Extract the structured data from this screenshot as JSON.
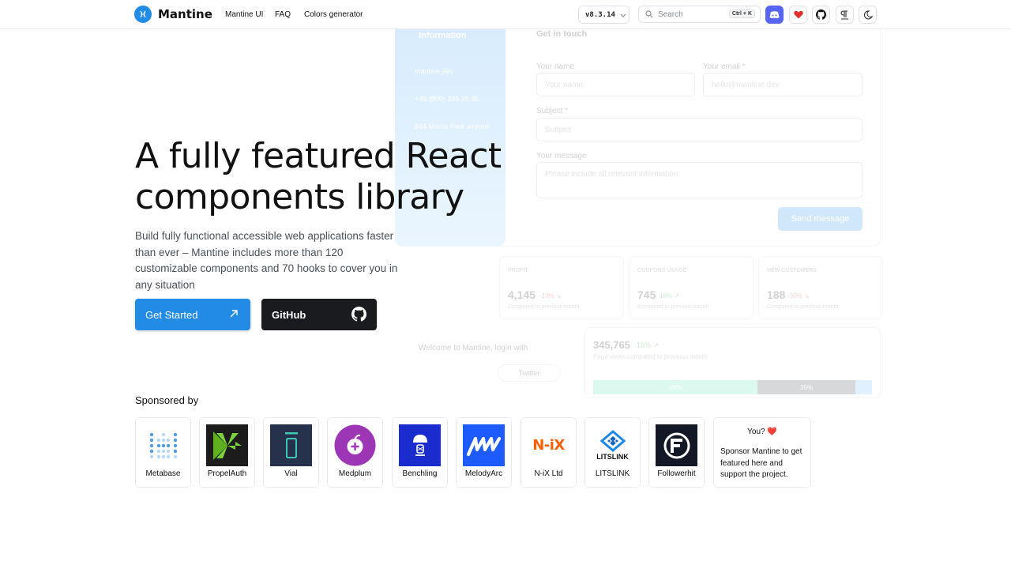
{
  "header": {
    "brand": "Mantine",
    "nav": [
      "Mantine UI",
      "FAQ",
      "Colors generator"
    ],
    "version": "v8.3.14",
    "search_placeholder": "Search",
    "search_shortcut": "Ctrl + K"
  },
  "background_demo": {
    "contact_title": "Get in touch",
    "info_title": "Information",
    "info_items": [
      "mantine.dev",
      "+49 (800) 335 35 35",
      "844 Morris Park avenue"
    ],
    "fields": {
      "name_label": "Your name",
      "name_placeholder": "Your name",
      "email_label": "Your email *",
      "email_placeholder": "hello@mantine.dev",
      "subject_label": "Subject *",
      "subject_placeholder": "Subject",
      "message_label": "Your message",
      "message_placeholder": "Please include all relevant information"
    },
    "send_button": "Send message",
    "stats": [
      {
        "label": "PROFIT",
        "value": "4,145",
        "diff": "-13% ↘",
        "caption": "Compared to previous month"
      },
      {
        "label": "COUPONS USAGE",
        "value": "745",
        "diff": "18% ↗",
        "caption": "Compared to previous month"
      },
      {
        "label": "NEW CUSTOMERS",
        "value": "188",
        "diff": "-30% ↘",
        "caption": "Compared to previous month"
      }
    ],
    "page_views": {
      "value": "345,765",
      "diff": "18% ↗",
      "caption": "Page views compared to previous month",
      "segments": [
        "59%",
        "35%"
      ]
    },
    "login_text": "Welcome to Mantine, login with",
    "twitter_button": "Twitter"
  },
  "hero": {
    "title_line1": "A fully featured React",
    "title_line2": "components library",
    "description": "Build fully functional accessible web applications faster than ever – Mantine includes more than 120 customizable components and 70 hooks to cover you in any situation",
    "get_started": "Get Started",
    "github": "GitHub"
  },
  "sponsors": {
    "heading": "Sponsored by",
    "items": [
      "Metabase",
      "PropelAuth",
      "Vial",
      "Medplum",
      "Benchling",
      "MelodyArc",
      "N-iX Ltd",
      "LITSLINK",
      "Followerhit"
    ],
    "you_title": "You? ❤️",
    "you_text": "Sponsor Mantine to get featured here and support the project.",
    "logo_text_nix": "N-iX",
    "logo_text_litslink": "LITSLINK"
  },
  "colors": {
    "primary": "#228be6",
    "dark": "#1a1b1e",
    "discord": "#5865f2",
    "heart": "#e03131"
  }
}
